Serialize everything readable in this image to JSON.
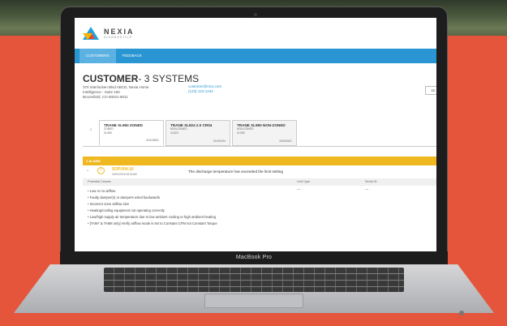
{
  "brand": {
    "name": "NEXIA",
    "sub": "DIAGNOSTICS"
  },
  "nav": {
    "items": [
      "CUSTOMERS",
      "FEEDBACK"
    ]
  },
  "customer": {
    "title_bold": "CUSTOMER",
    "title_rest": "- 3 SYSTEMS",
    "address_line1": "370 Interlocken Blvd ABCD, Nexia Home",
    "address_line2": "Intelligence - Suite 150",
    "address_line3": "Broomfield, CO 80021-8011",
    "email": "customer@nico.com",
    "phone": "(123) 123-1234",
    "edit_label": "ED"
  },
  "systems": [
    {
      "name": "TRANE XL950 ZONED",
      "zone": "ZONED",
      "model": "XL950",
      "serial": "0041060C"
    },
    {
      "name": "TRANE XL824 2.0 CR04",
      "zone": "NON-ZONED",
      "model": "XL824",
      "serial": "01400194"
    },
    {
      "name": "TRANE XL950 NON-ZONED",
      "zone": "NON-ZONED",
      "model": "XL950",
      "serial": "0040002C"
    }
  ],
  "alarm": {
    "count_label": "1 ALARM",
    "code": "SOP.004.16",
    "timestamp": "04/01/2016 08:31AM",
    "message": "The discharge temperature has exceeded the limit setting",
    "columns": {
      "causes": "Potential Causes",
      "unit_type": "Unit Type",
      "serial": "Serial ID"
    },
    "unit_type_value": "—",
    "serial_value": "—",
    "causes": [
      "Low or no airflow",
      "Faulty damper(s) or dampers wired backwards",
      "Incorrect zone airflow size",
      "Heating/cooling equipment not operating correctly",
      "Low/high supply air temperature due to low ambient cooling or high ambient heating",
      "[TAM7 & TAM8 only] Verify airflow mode is set to Constant CFM not Constant Torque"
    ]
  },
  "laptop": {
    "brand_label": "MacBook Pro"
  }
}
